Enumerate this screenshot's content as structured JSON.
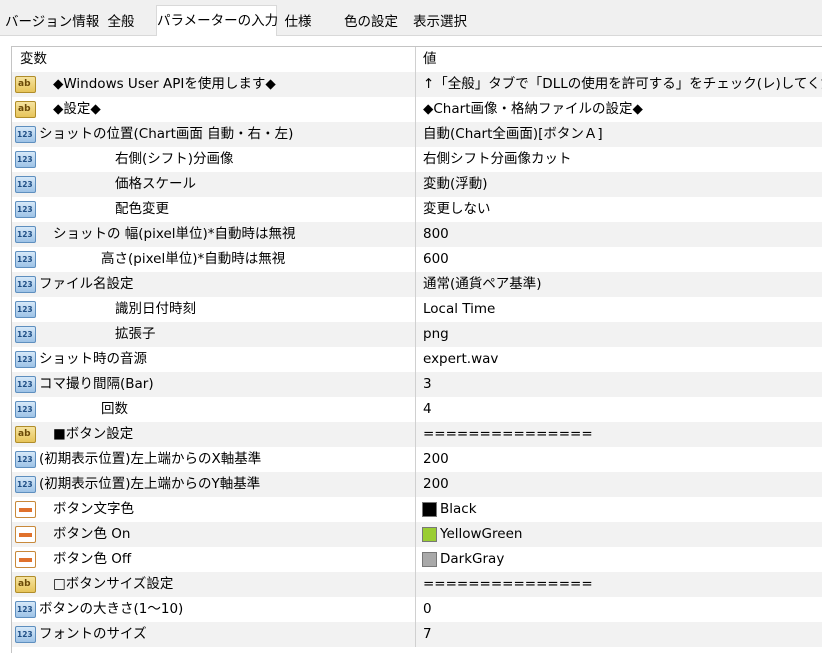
{
  "tabs": [
    {
      "label": "バージョン情報"
    },
    {
      "label": "全般"
    },
    {
      "label": "パラメーターの入力"
    },
    {
      "label": "仕様"
    },
    {
      "label": "色の設定"
    },
    {
      "label": "表示選択"
    }
  ],
  "active_tab": "パラメーターの入力",
  "table": {
    "header": {
      "variable": "変数",
      "value": "値"
    },
    "rows": [
      {
        "type": "ab",
        "variable": "◆Windows User APIを使用します◆",
        "value": "↑「全般」タブで「DLLの使用を許可する」をチェック(レ)してください"
      },
      {
        "type": "ab",
        "variable": "◆設定◆",
        "value": "◆Chart画像・格納ファイルの設定◆"
      },
      {
        "type": "num",
        "variable": "ショットの位置(Chart画面 自動・右・左)",
        "value": "自動(Chart全画面)[ボタンＡ]"
      },
      {
        "type": "num",
        "variable": "右側(シフト)分画像",
        "value": "右側シフト分画像カット"
      },
      {
        "type": "num",
        "variable": "価格スケール",
        "value": "変動(浮動)"
      },
      {
        "type": "num",
        "variable": "配色変更",
        "value": "変更しない"
      },
      {
        "type": "num",
        "variable": "ショットの 幅(pixel単位)*自動時は無視",
        "value": "800"
      },
      {
        "type": "num",
        "variable": "高さ(pixel単位)*自動時は無視",
        "value": "600"
      },
      {
        "type": "num",
        "variable": "ファイル名設定",
        "value": "通常(通貨ペア基準)"
      },
      {
        "type": "num",
        "variable": "識別日付時刻",
        "value": "Local Time"
      },
      {
        "type": "num",
        "variable": "拡張子",
        "value": "png"
      },
      {
        "type": "num",
        "variable": "ショット時の音源",
        "value": "expert.wav"
      },
      {
        "type": "num",
        "variable": "コマ撮り間隔(Bar)",
        "value": "3"
      },
      {
        "type": "num",
        "variable": "回数",
        "value": "4"
      },
      {
        "type": "ab",
        "variable": "■ボタン設定",
        "value": "==============="
      },
      {
        "type": "num",
        "variable": "(初期表示位置)左上端からのX軸基準",
        "value": "200"
      },
      {
        "type": "num",
        "variable": "(初期表示位置)左上端からのY軸基準",
        "value": "200"
      },
      {
        "type": "color",
        "variable": "ボタン文字色",
        "value": "Black",
        "color": "#000000"
      },
      {
        "type": "color",
        "variable": "ボタン色 On",
        "value": "YellowGreen",
        "color": "#9acd32"
      },
      {
        "type": "color",
        "variable": "ボタン色 Off",
        "value": "DarkGray",
        "color": "#a9a9a9"
      },
      {
        "type": "ab",
        "variable": "□ボタンサイズ設定",
        "value": "==============="
      },
      {
        "type": "num",
        "variable": "ボタンの大きさ(1～10)",
        "value": "0"
      },
      {
        "type": "num",
        "variable": "フォントのサイズ",
        "value": "7"
      }
    ]
  },
  "icons": {
    "text": "ab",
    "number": "123"
  }
}
